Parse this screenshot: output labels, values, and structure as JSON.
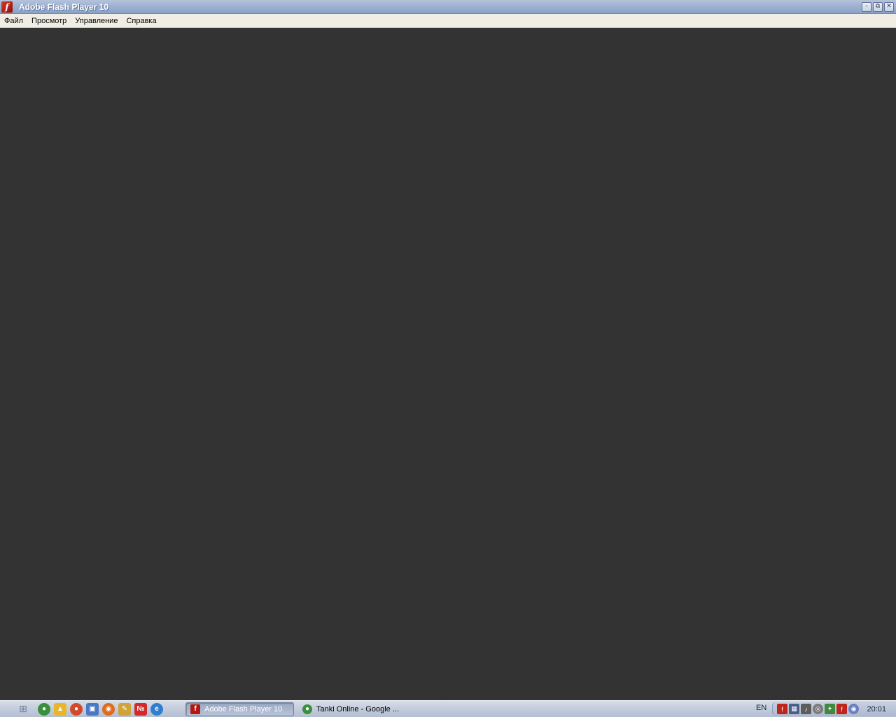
{
  "window": {
    "title": "Adobe Flash Player 10",
    "controls": {
      "minimize": "–",
      "restore": "⧉",
      "close": "✕"
    }
  },
  "menubar": {
    "items": [
      "Файл",
      "Просмотр",
      "Управление",
      "Справка"
    ]
  },
  "content": {
    "background": "#333333"
  },
  "taskbar": {
    "start_icon": "windows-logo-icon",
    "quick_launch": [
      {
        "name": "chrome-icon",
        "color": "#3a8f3a"
      },
      {
        "name": "google-drive-icon",
        "color": "#e9b52a"
      },
      {
        "name": "chromium-icon",
        "color": "#d24a2a"
      },
      {
        "name": "finder-icon",
        "color": "#4a78c7"
      },
      {
        "name": "firefox-icon",
        "color": "#e26a18"
      },
      {
        "name": "pencil-tool-icon",
        "color": "#d0a23a"
      },
      {
        "name": "yandex-icon",
        "color": "#d22a2a"
      },
      {
        "name": "internet-explorer-icon",
        "color": "#2f7fd0"
      }
    ],
    "tasks": [
      {
        "label": "Adobe Flash Player 10",
        "active": true,
        "icon": "flash-player-icon"
      },
      {
        "label": "Tanki Online - Google ...",
        "active": false,
        "icon": "chrome-icon"
      }
    ],
    "language": "EN",
    "tray_icons": [
      {
        "name": "flash-tray-icon",
        "color": "#c0251b"
      },
      {
        "name": "network-icon",
        "color": "#4a5e8a"
      },
      {
        "name": "volume-icon",
        "color": "#5c5c5c"
      },
      {
        "name": "disc-icon",
        "color": "#7a7a7a"
      },
      {
        "name": "antivirus-icon",
        "color": "#3f8a3f"
      },
      {
        "name": "flash-update-icon",
        "color": "#c0251b"
      },
      {
        "name": "eye-icon",
        "color": "#6a7fc0"
      }
    ],
    "clock": "20:01"
  }
}
